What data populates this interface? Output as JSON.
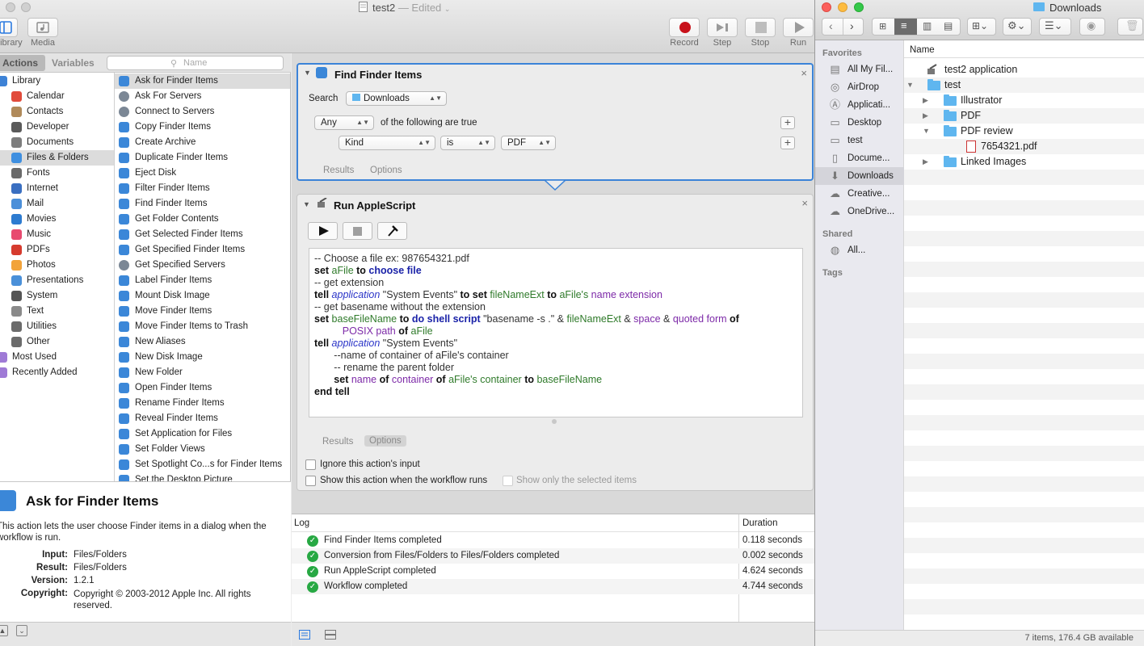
{
  "automator": {
    "window_title": "test2",
    "window_status": "— Edited",
    "toolbar": {
      "library_label": "Library",
      "media_label": "Media",
      "record_label": "Record",
      "step_label": "Step",
      "stop_label": "Stop",
      "run_label": "Run"
    },
    "tabs": {
      "actions": "Actions",
      "variables": "Variables",
      "search_placeholder": "Name"
    },
    "library": [
      {
        "label": "Library",
        "color": "#3d82d6"
      },
      {
        "label": "Calendar",
        "color": "#e14b3b"
      },
      {
        "label": "Contacts",
        "color": "#b08a5a"
      },
      {
        "label": "Developer",
        "color": "#5a5a5a"
      },
      {
        "label": "Documents",
        "color": "#7d7d7d"
      },
      {
        "label": "Files & Folders",
        "color": "#3f8fe0"
      },
      {
        "label": "Fonts",
        "color": "#6a6a6a"
      },
      {
        "label": "Internet",
        "color": "#3a6fc1"
      },
      {
        "label": "Mail",
        "color": "#4b8fd9"
      },
      {
        "label": "Movies",
        "color": "#2d7bd0"
      },
      {
        "label": "Music",
        "color": "#e84a6f"
      },
      {
        "label": "PDFs",
        "color": "#d63b2e"
      },
      {
        "label": "Photos",
        "color": "#f2a33a"
      },
      {
        "label": "Presentations",
        "color": "#4a90d9"
      },
      {
        "label": "System",
        "color": "#555555"
      },
      {
        "label": "Text",
        "color": "#8a8a8a"
      },
      {
        "label": "Utilities",
        "color": "#6b6b6b"
      },
      {
        "label": "Other",
        "color": "#6b6b6b"
      },
      {
        "label": "Most Used",
        "color": "#9f7ad6"
      },
      {
        "label": "Recently Added",
        "color": "#9f7ad6"
      }
    ],
    "library_selected_index": 5,
    "actions": [
      "Ask for Finder Items",
      "Ask For Servers",
      "Connect to Servers",
      "Copy Finder Items",
      "Create Archive",
      "Duplicate Finder Items",
      "Eject Disk",
      "Filter Finder Items",
      "Find Finder Items",
      "Get Folder Contents",
      "Get Selected Finder Items",
      "Get Specified Finder Items",
      "Get Specified Servers",
      "Label Finder Items",
      "Mount Disk Image",
      "Move Finder Items",
      "Move Finder Items to Trash",
      "New Aliases",
      "New Disk Image",
      "New Folder",
      "Open Finder Items",
      "Rename Finder Items",
      "Reveal Finder Items",
      "Set Application for Files",
      "Set Folder Views",
      "Set Spotlight Co...s for Finder Items",
      "Set the Desktop Picture"
    ],
    "actions_selected_index": 0,
    "description": {
      "title": "Ask for Finder Items",
      "text": "This action lets the user choose Finder items in a dialog when the workflow is run.",
      "input_label": "Input:",
      "input_value": "Files/Folders",
      "result_label": "Result:",
      "result_value": "Files/Folders",
      "version_label": "Version:",
      "version_value": "1.2.1",
      "copyright_label": "Copyright:",
      "copyright_value": "Copyright © 2003-2012 Apple Inc.  All rights reserved."
    },
    "find_action": {
      "title": "Find Finder Items",
      "search_label": "Search",
      "search_value": "Downloads",
      "match_value": "Any",
      "match_suffix": "of the following are true",
      "criterion_field": "Kind",
      "criterion_op": "is",
      "criterion_value": "PDF",
      "results_tab": "Results",
      "options_tab": "Options"
    },
    "script_action": {
      "title": "Run AppleScript",
      "results_tab": "Results",
      "options_tab": "Options",
      "ignore_input": "Ignore this action's input",
      "show_action": "Show this action when the workflow runs",
      "show_selected": "Show only the selected items"
    },
    "script_lines": [
      [
        {
          "t": "-- Choose a file ex: 987654321.pdf",
          "c": "cm"
        }
      ],
      [
        {
          "t": "set ",
          "c": "kw"
        },
        {
          "t": "aFile ",
          "c": "vr"
        },
        {
          "t": "to ",
          "c": "kw"
        },
        {
          "t": "choose file",
          "c": "kwb"
        }
      ],
      [
        {
          "t": "-- get extension",
          "c": "cm"
        }
      ],
      [
        {
          "t": "tell ",
          "c": "kw"
        },
        {
          "t": "application ",
          "c": "ap"
        },
        {
          "t": "\"System Events\" ",
          "c": "cm"
        },
        {
          "t": "to set ",
          "c": "kw"
        },
        {
          "t": "fileNameExt ",
          "c": "vr"
        },
        {
          "t": "to ",
          "c": "kw"
        },
        {
          "t": "aFile's ",
          "c": "vr"
        },
        {
          "t": "name extension",
          "c": "pr"
        }
      ],
      [
        {
          "t": "-- get basename without the extension",
          "c": "cm"
        }
      ],
      [
        {
          "t": "set ",
          "c": "kw"
        },
        {
          "t": "baseFileName ",
          "c": "vr"
        },
        {
          "t": "to ",
          "c": "kw"
        },
        {
          "t": "do shell script ",
          "c": "kwb"
        },
        {
          "t": "\"basename -s .\" & ",
          "c": "cm"
        },
        {
          "t": "fileNameExt ",
          "c": "vr"
        },
        {
          "t": "& ",
          "c": "cm"
        },
        {
          "t": "space ",
          "c": "pr"
        },
        {
          "t": "& ",
          "c": "cm"
        },
        {
          "t": "quoted form ",
          "c": "pr"
        },
        {
          "t": "of",
          "c": "kw"
        }
      ],
      [
        {
          "t": "          POSIX path ",
          "c": "pr"
        },
        {
          "t": "of ",
          "c": "kw"
        },
        {
          "t": "aFile",
          "c": "vr"
        }
      ],
      [
        {
          "t": "tell ",
          "c": "kw"
        },
        {
          "t": "application ",
          "c": "ap"
        },
        {
          "t": "\"System Events\"",
          "c": "cm"
        }
      ],
      [
        {
          "t": "       --name of container of aFile's container",
          "c": "cm"
        }
      ],
      [
        {
          "t": "       -- rename the parent folder",
          "c": "cm"
        }
      ],
      [
        {
          "t": "       set ",
          "c": "kw"
        },
        {
          "t": "name ",
          "c": "pr"
        },
        {
          "t": "of ",
          "c": "kw"
        },
        {
          "t": "container ",
          "c": "pr"
        },
        {
          "t": "of ",
          "c": "kw"
        },
        {
          "t": "aFile's container ",
          "c": "vr"
        },
        {
          "t": "to ",
          "c": "kw"
        },
        {
          "t": "baseFileName",
          "c": "vr"
        }
      ],
      [
        {
          "t": "end tell",
          "c": "kw"
        }
      ]
    ],
    "log": {
      "log_header": "Log",
      "duration_header": "Duration",
      "rows": [
        {
          "text": "Find Finder Items completed",
          "duration": "0.118 seconds"
        },
        {
          "text": "Conversion from Files/Folders to Files/Folders completed",
          "duration": "0.002 seconds"
        },
        {
          "text": "Run AppleScript completed",
          "duration": "4.624 seconds"
        },
        {
          "text": "Workflow completed",
          "duration": "4.744 seconds"
        }
      ]
    }
  },
  "finder": {
    "title": "Downloads",
    "favorites_header": "Favorites",
    "shared_header": "Shared",
    "tags_header": "Tags",
    "favorites": [
      {
        "label": "All My Fil...",
        "icon": "all-files-icon"
      },
      {
        "label": "AirDrop",
        "icon": "airdrop-icon"
      },
      {
        "label": "Applicati...",
        "icon": "applications-icon"
      },
      {
        "label": "Desktop",
        "icon": "desktop-icon"
      },
      {
        "label": "test",
        "icon": "folder-icon"
      },
      {
        "label": "Docume...",
        "icon": "documents-icon"
      },
      {
        "label": "Downloads",
        "icon": "downloads-icon"
      },
      {
        "label": "Creative...",
        "icon": "creative-cloud-icon"
      },
      {
        "label": "OneDrive...",
        "icon": "onedrive-icon"
      }
    ],
    "favorites_selected_index": 6,
    "shared": [
      {
        "label": "All...",
        "icon": "network-icon"
      }
    ],
    "column_header": "Name",
    "files": [
      {
        "label": "test2 application",
        "kind": "app",
        "depth": 0,
        "disclosure": ""
      },
      {
        "label": "test",
        "kind": "folder",
        "depth": 0,
        "disclosure": "▼"
      },
      {
        "label": "Illustrator",
        "kind": "folder",
        "depth": 1,
        "disclosure": "▶"
      },
      {
        "label": "PDF",
        "kind": "folder",
        "depth": 1,
        "disclosure": "▶"
      },
      {
        "label": "PDF review",
        "kind": "folder",
        "depth": 1,
        "disclosure": "▼"
      },
      {
        "label": "7654321.pdf",
        "kind": "pdf",
        "depth": 2,
        "disclosure": ""
      },
      {
        "label": "Linked Images",
        "kind": "folder",
        "depth": 1,
        "disclosure": "▶"
      }
    ],
    "status": "7 items, 176.4 GB available"
  }
}
